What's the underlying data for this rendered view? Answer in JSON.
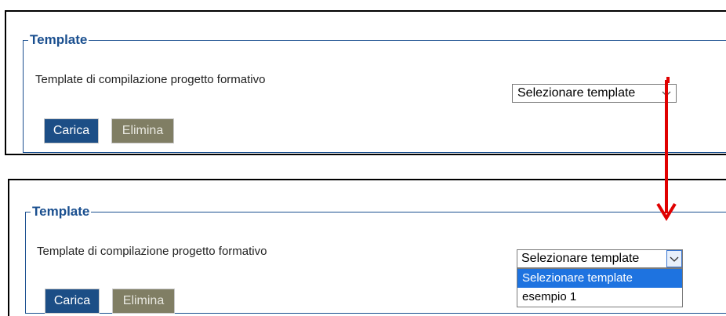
{
  "panels": [
    {
      "legend": "Template",
      "field_label": "Template di compilazione progetto formativo",
      "select_value": "Selezionare template",
      "buttons": {
        "load": "Carica",
        "delete": "Elimina"
      }
    },
    {
      "legend": "Template",
      "field_label": "Template di compilazione progetto formativo",
      "select_value": "Selezionare template",
      "buttons": {
        "load": "Carica",
        "delete": "Elimina"
      },
      "dropdown_options": [
        "Selezionare template",
        "esempio 1"
      ],
      "highlighted_option": "Selezionare template"
    }
  ],
  "colors": {
    "primary_button": "#1c4e86",
    "secondary_button": "#807e64",
    "fieldset_border": "#1a4f8f",
    "highlight": "#1e73e0",
    "annotation_arrow": "#e00000"
  },
  "icons": {
    "select_toggle": "chevron-down-icon",
    "annotation": "arrow-down-icon"
  }
}
